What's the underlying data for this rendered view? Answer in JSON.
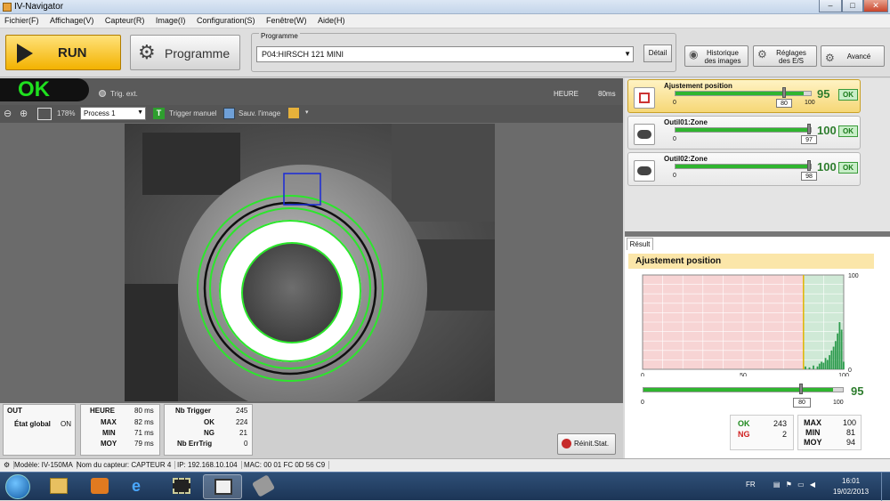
{
  "window": {
    "title": "IV-Navigator",
    "min": "–",
    "max": "□",
    "close": "✕"
  },
  "menu": [
    "Fichier(F)",
    "Affichage(V)",
    "Capteur(R)",
    "Image(I)",
    "Configuration(S)",
    "Fenêtre(W)",
    "Aide(H)"
  ],
  "toolbar": {
    "run_label": "RUN",
    "programme_label": "Programme",
    "programme_group": "Programme",
    "programme_value": "P04:HIRSCH 121 MINI",
    "detail_label": "Détail",
    "historique_l1": "Historique",
    "historique_l2": "des images",
    "reglages_l1": "Réglages",
    "reglages_l2": "des E/S",
    "avance_label": "Avancé"
  },
  "status": {
    "result": "OK",
    "trig_ext": "Trig. ext.",
    "heure_label": "HEURE",
    "heure_value": "80ms"
  },
  "imagetools": {
    "zoom": "178%",
    "process": "Process 1",
    "trigger_manuel": "Trigger manuel",
    "sauv_image": "Sauv. l'image"
  },
  "stats": {
    "out": {
      "title": "OUT",
      "etat_label": "État global",
      "etat_value": "ON"
    },
    "heure": {
      "title": "HEURE",
      "title_value": "80 ms",
      "max_label": "MAX",
      "max_value": "82 ms",
      "min_label": "MIN",
      "min_value": "71 ms",
      "moy_label": "MOY",
      "moy_value": "79 ms"
    },
    "trigger": {
      "title": "Nb Trigger",
      "title_value": "245",
      "ok_label": "OK",
      "ok_value": "224",
      "ng_label": "NG",
      "ng_value": "21",
      "err_label": "Nb ErrTrig",
      "err_value": "0"
    },
    "reinit_label": "Réinit.Stat."
  },
  "tools": [
    {
      "name": "Ajustement position",
      "value": "95",
      "threshold": "80",
      "min": "0",
      "max": "100",
      "status": "OK",
      "fill": 0.95
    },
    {
      "name": "Outil01:Zone",
      "value": "100",
      "threshold": "97",
      "min": "0",
      "max": "100",
      "status": "OK",
      "fill": 1.0
    },
    {
      "name": "Outil02:Zone",
      "value": "100",
      "threshold": "98",
      "min": "0",
      "max": "100",
      "status": "OK",
      "fill": 1.0
    }
  ],
  "result": {
    "tab": "Résult",
    "title": "Ajustement position",
    "value": "95",
    "threshold": "80",
    "min": "0",
    "max": "100",
    "fill": 0.95,
    "ok_label": "OK",
    "ok_value": "243",
    "ng_label": "NG",
    "ng_value": "2",
    "max_label": "MAX",
    "max_value": "100",
    "min_label": "MIN",
    "min_value": "81",
    "moy_label": "MOY",
    "moy_value": "94"
  },
  "chart_data": {
    "type": "bar",
    "title": "",
    "x_ticks": [
      "0",
      "50",
      "100"
    ],
    "y_ticks": [
      "0",
      "100"
    ],
    "xlim": [
      0,
      100
    ],
    "ylim": [
      0,
      100
    ],
    "threshold": 80,
    "x": [
      81,
      83,
      85,
      87,
      88,
      89,
      90,
      91,
      92,
      93,
      94,
      95,
      96,
      97,
      98,
      99,
      100
    ],
    "values": [
      3,
      2,
      4,
      3,
      6,
      8,
      7,
      12,
      10,
      15,
      20,
      24,
      30,
      38,
      50,
      42,
      8
    ],
    "colors": {
      "ng_zone": "#f7d4d4",
      "ok_zone": "#cfe9d6",
      "bar": "#2f9c4f",
      "threshold": "#e0b400"
    }
  },
  "statusbar": {
    "modele": "Modèle: IV-150MA",
    "capteur": "Nom du capteur: CAPTEUR 4",
    "ip": "IP: 192.168.10.104",
    "mac": "MAC: 00 01 FC 0D 56 C9"
  },
  "taskbar": {
    "lang": "FR",
    "time": "16:01",
    "date": "19/02/2013"
  }
}
